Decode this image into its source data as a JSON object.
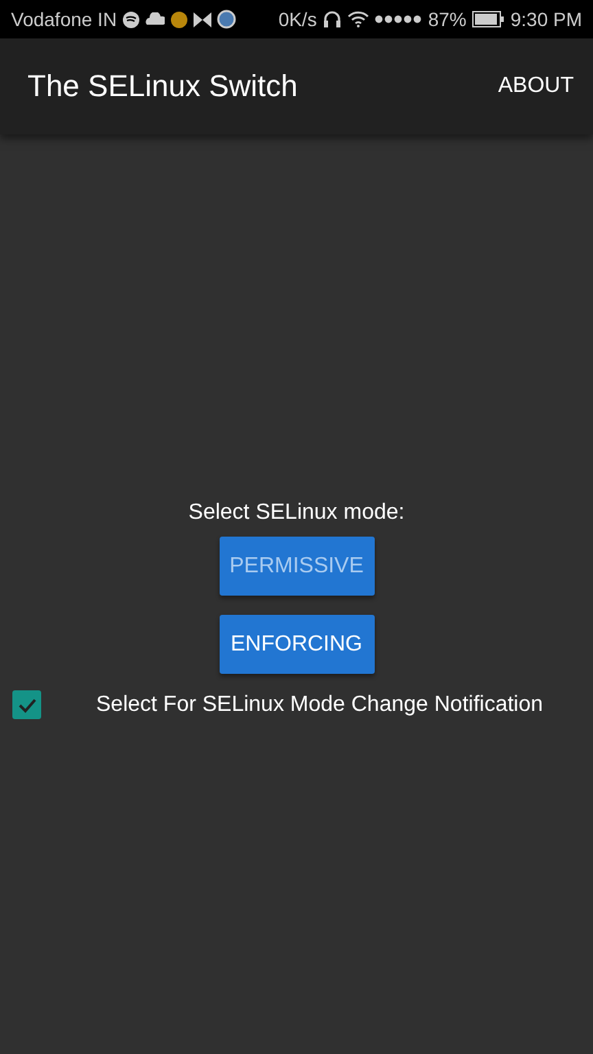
{
  "status_bar": {
    "carrier": "Vodafone IN",
    "speed": "0K/s",
    "battery": "87%",
    "time": "9:30 PM"
  },
  "app_bar": {
    "title": "The SELinux Switch",
    "action": "ABOUT"
  },
  "prompt": "Select SELinux mode:",
  "mode_buttons": [
    {
      "label": "PERMISSIVE",
      "disabled": true
    },
    {
      "label": "ENFORCING",
      "disabled": false
    }
  ],
  "notification_option": {
    "label": "Select For SELinux Mode Change Notification",
    "checked": true
  }
}
